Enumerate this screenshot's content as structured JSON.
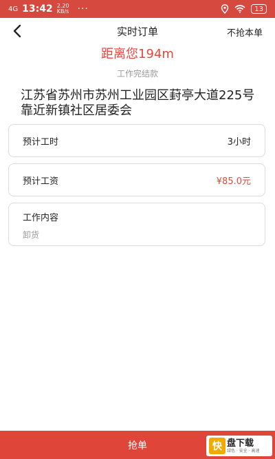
{
  "status_bar": {
    "network": "4G",
    "time": "13:42",
    "speed_value": "2.20",
    "speed_unit": "KB/s",
    "dots": "···",
    "battery": "13"
  },
  "nav": {
    "title": "实时订单",
    "action": "不抢本单"
  },
  "order": {
    "distance": "距离您194m",
    "type": "工作完结款",
    "address": "江苏省苏州市苏州工业园区葑亭大道225号靠近新镇社区居委会"
  },
  "details": {
    "hours_label": "预计工时",
    "hours_value": "3小时",
    "wage_label": "预计工资",
    "wage_value": "¥85.0元",
    "content_label": "工作内容",
    "content_value": "卸货"
  },
  "footer": {
    "grab_label": "抢单"
  },
  "watermark": {
    "logo": "快",
    "name": "盘下载",
    "sub": "绿色 · 安全 · 高速"
  },
  "colors": {
    "accent": "#e5473c",
    "status_bar": "#d6493f",
    "button": "#e0453a"
  }
}
